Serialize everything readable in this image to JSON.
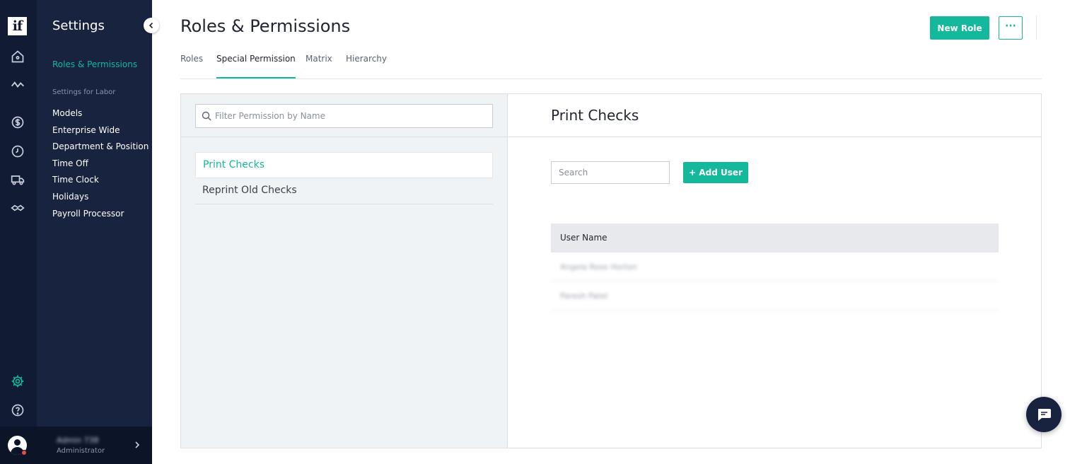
{
  "rail": {
    "logo_text": "if",
    "icons": [
      "home-icon",
      "activity-icon",
      "dollar-icon",
      "clock-icon",
      "truck-icon",
      "handshake-icon",
      "gear-icon",
      "help-icon"
    ],
    "active_color": "#14b89a"
  },
  "settings_panel": {
    "title": "Settings",
    "active_link": "Roles & Permissions",
    "section_label": "Settings for Labor",
    "items": [
      "Models",
      "Enterprise Wide",
      "Department & Position",
      "Time Off",
      "Time Clock",
      "Holidays",
      "Payroll Processor"
    ]
  },
  "user": {
    "name": "Admin 738",
    "role": "Administrator"
  },
  "header": {
    "title": "Roles & Permissions",
    "new_role_label": "New Role",
    "more_label": "···"
  },
  "tabs": [
    "Roles",
    "Special Permission",
    "Matrix",
    "Hierarchy"
  ],
  "active_tab": "Special Permission",
  "permissions": {
    "filter_placeholder": "Filter Permission by Name",
    "items": [
      "Print Checks",
      "Reprint Old Checks"
    ],
    "selected": "Print Checks"
  },
  "detail": {
    "title": "Print Checks",
    "search_placeholder": "Search",
    "add_user_label": "+ Add User",
    "table_header": "User Name",
    "rows": [
      "Angela Rose Horton",
      "Paresh Patel"
    ]
  },
  "colors": {
    "accent": "#14b89a",
    "sidebar": "#17233f",
    "rail": "#111b33"
  }
}
